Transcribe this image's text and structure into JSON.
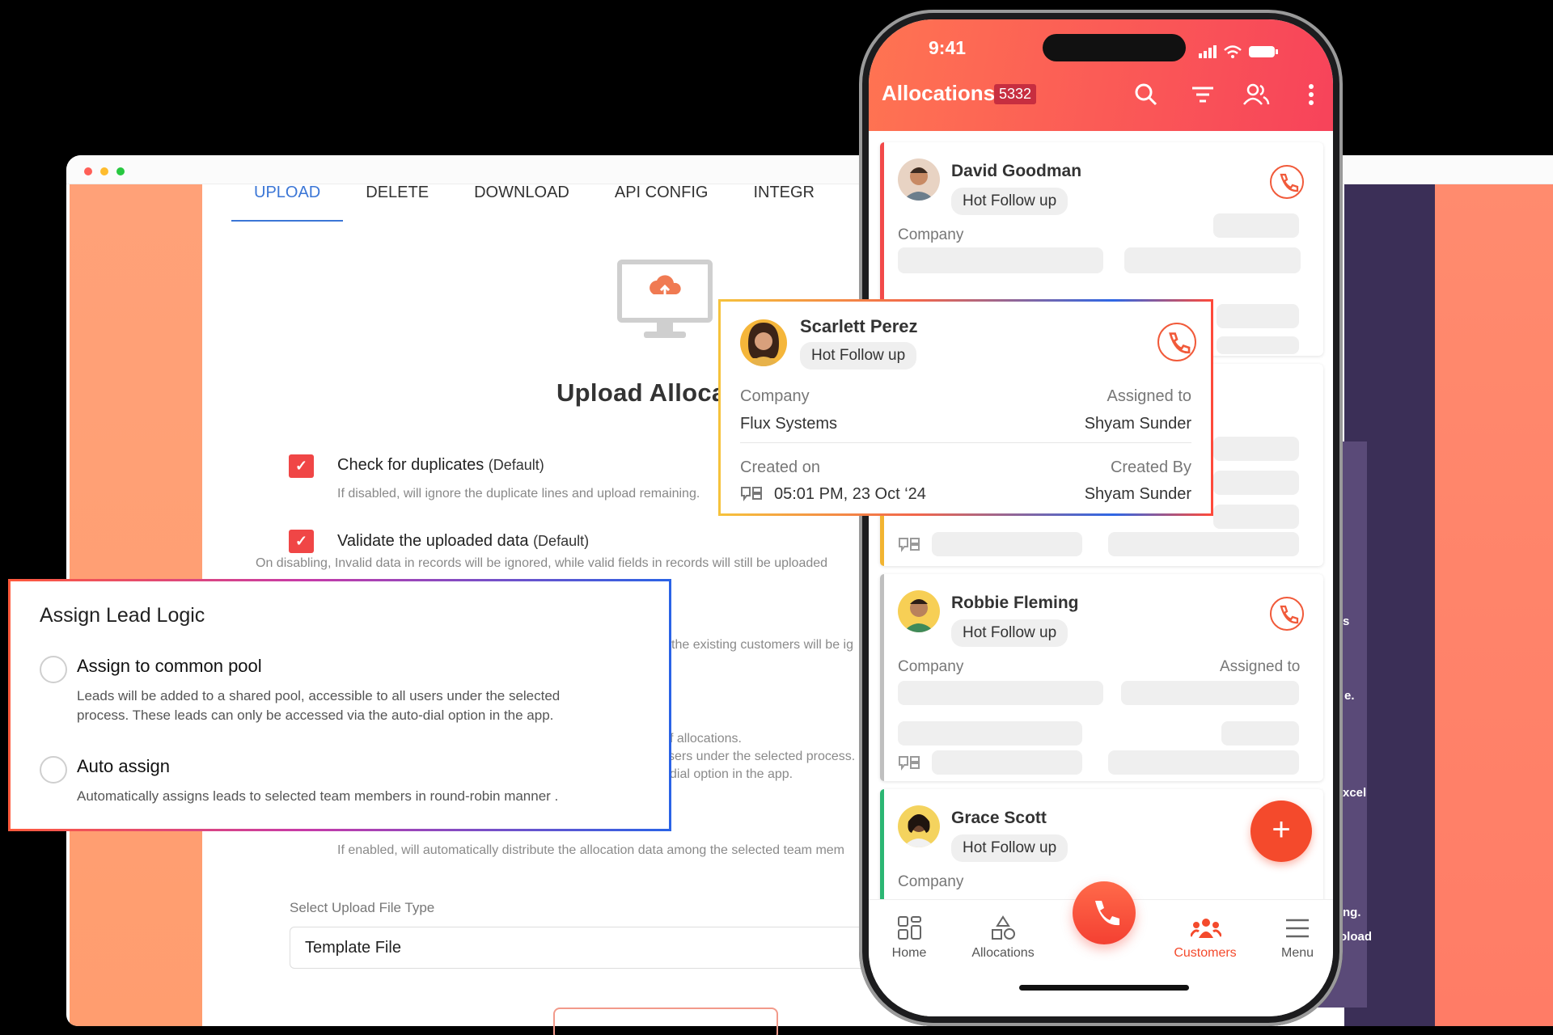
{
  "desktop": {
    "tabs": [
      {
        "label": "UPLOAD",
        "active": true
      },
      {
        "label": "DELETE",
        "active": false
      },
      {
        "label": "DOWNLOAD",
        "active": false
      },
      {
        "label": "API CONFIG",
        "active": false
      },
      {
        "label": "INTEGR",
        "active": false
      }
    ],
    "upload_title": "Upload Alloca",
    "options": [
      {
        "label": "Check for duplicates",
        "tag": "(Default)",
        "desc": "If disabled, will ignore the duplicate lines and upload remaining.",
        "checked": true
      },
      {
        "label": "Validate the uploaded data",
        "tag": "(Default)",
        "desc": "On disabling, Invalid data in records will be ignored, while valid fields in records will still be uploaded",
        "checked": true
      }
    ],
    "partial_texts": {
      "existing_customers": "the existing customers will be ig",
      "allocations": "f allocations.",
      "users_process": "sers under the selected process.",
      "dial_option": "dial option in the app.",
      "auto_distribute": "If enabled, will automatically distribute the allocation data among the selected team mem"
    },
    "file_type_label": "Select Upload File Type",
    "file_type_value": "Template File",
    "right_panel_fragments": [
      "s",
      "e.",
      "xcel",
      "ng.",
      "oload"
    ]
  },
  "assign_logic": {
    "title": "Assign Lead Logic",
    "options": [
      {
        "label": "Assign to common pool",
        "desc_line1": "Leads will be added to a shared pool, accessible to all users under the selected",
        "desc_line2": "process. These leads can only be accessed via the auto-dial option in the app."
      },
      {
        "label": "Auto assign",
        "desc_line1": "Automatically assigns leads to selected team members in round-robin manner .",
        "desc_line2": ""
      }
    ]
  },
  "phone": {
    "time": "9:41",
    "title": "Allocations",
    "count": "5332",
    "accent": "#f44a2c",
    "header_icons": [
      "search-icon",
      "filter-icon",
      "users-icon",
      "more-vertical-icon"
    ],
    "cards": [
      {
        "name": "David Goodman",
        "tag": "Hot Follow up",
        "company_label": "Company",
        "edge": "#f24a4a"
      },
      {
        "name": "Robbie Fleming",
        "tag": "Hot Follow up",
        "company_label": "Company",
        "assigned_label": "Assigned to",
        "edge": "#bfbfbf"
      },
      {
        "name": "Grace Scott",
        "tag": "Hot Follow up",
        "company_label": "Company",
        "edge": "#2bb673"
      }
    ],
    "nav": [
      {
        "label": "Home",
        "icon": "home-grid-icon",
        "active": false
      },
      {
        "label": "Allocations",
        "icon": "shapes-icon",
        "active": false
      },
      {
        "label": "Customers",
        "icon": "customers-icon",
        "active": true
      },
      {
        "label": "Menu",
        "icon": "menu-icon",
        "active": false
      }
    ],
    "fab_label": "+"
  },
  "detail_card": {
    "name": "Scarlett Perez",
    "tag": "Hot Follow up",
    "company_label": "Company",
    "company_value": "Flux Systems",
    "assigned_label": "Assigned to",
    "assigned_value": "Shyam Sunder",
    "created_on_label": "Created on",
    "created_on_value": "05:01 PM, 23 Oct ‘24",
    "created_by_label": "Created By",
    "created_by_value": "Shyam Sunder"
  }
}
